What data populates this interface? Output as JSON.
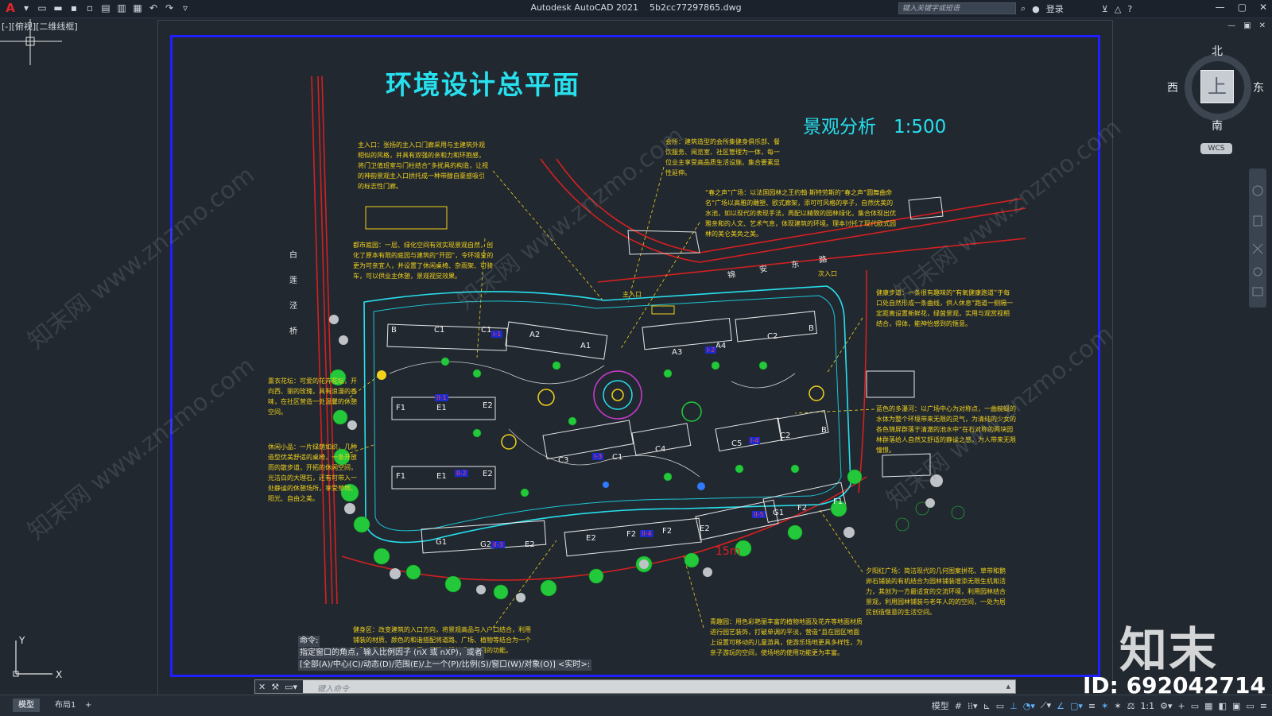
{
  "app": {
    "title": "Autodesk AutoCAD 2021",
    "filename": "5b2cc77297865.dwg",
    "search_placeholder": "键入关键字或短语",
    "login": "登录"
  },
  "viewport": {
    "view_label": "[-][俯视][二维线框]"
  },
  "drawing": {
    "title": "环境设计总平面",
    "subtitle": "景观分析",
    "scale": "1:500",
    "street_west": [
      "白",
      "莲",
      "泾",
      "桥"
    ],
    "street_north": [
      "锦",
      "安",
      "东",
      "路"
    ],
    "labels": {
      "main_entry": "主入口",
      "secondary_entry": "次入口",
      "dimension": "15m"
    },
    "buildings": [
      "B",
      "C1",
      "C1",
      "A2",
      "A1",
      "A3",
      "A4",
      "C2",
      "B",
      "F1",
      "E1",
      "E2",
      "F1",
      "E1",
      "E2",
      "C3",
      "C1",
      "C4",
      "C5",
      "C2",
      "B",
      "G1",
      "G2",
      "E2",
      "E2",
      "F2",
      "F2",
      "E2",
      "G1",
      "F2",
      "F1"
    ],
    "phase_tags": [
      "I-1",
      "II-1",
      "II-2",
      "II-3",
      "I-2",
      "I-3",
      "I-4",
      "II-4",
      "II-5"
    ],
    "notes": {
      "main_entrance": "主入口：张扬的主入口门廊采用与主建筑外观相似的风格，并具有双强的亲和力和环抱感，将门卫值班室与门柱结合“多扰具的构造，让视的神韵景观主入口拱托成一种带醇自豪感吸引的标志性门廊。",
      "clubhouse": "会所：建筑造型的会所集健身俱乐部、餐饮服务、阅览室、社区管理为一体，每一位业主享受高品质生活设施，集合要素显性延伸。",
      "spring_square": "“春之声”广场：以法国园林之王约翰·斯特劳斯的“春之声”圆舞曲命名“广场以高雅的雕塑、欧式廊架，添可可风格的亭子，自然优美的水池，如以现代的表现手法，再配以精致的园林绿化，集合体现出优雅亲和的人文、艺术气息，体现建筑的环境。理本讨托了现代欧式园林的美仑美奂之美。",
      "west_garden": "都市庭园：一层、绿化空间有效实现景观自然，创化了原本有限的庭园与建筑的“开园”，令环境变的更为可亲宜人，并设置了休闲桌椅、杂雨架、可骑车，可以供业主休憩，景观视觉效果。",
      "fragrant": "熏衣花坛：可爱的花卉花坛，开向西、丽的玫瑰，具有浪漫的香味，在社区营造一处温馨的休憩空间。",
      "leisure": "休闲小品：一片绿荫如织，几种造型优美舒适的桌椅，一条开放而的散步道，开拓的休闲空间，光洁白的大理石，还有可带入一处静谧的休憩场所，享受草地、阳光、自由之美。",
      "health_path": "健康步道：一条很有趣味的“有氧健康跑道”于每口处自然形成一条曲线，供人休息“跑道一侧隔一定距离设置新鲜花，绿茵景观，实用与观赏视相结合，得体，能神怡感到的惬意。",
      "blue_water": "蓝色的多瀑河：以广场中心为对称点，一曲蜿蜒的水体为整个环境带来无限的灵气，为清纯的少女的各色锦屏群落于清澈的池水中“在石对称的两块园林群落给人自然又舒适的静谧之感，为人带来无限憧憬。",
      "sunset": "夕阳红广场：简洁现代的几何图案拼花、草带和鹅卵石铺装的有机结合为园林铺装增添无限生机和活力，其创为一方最适宜的交流环境，利用园林结合景观，利用园林铺装与老年人的的空间，一处为居民创造惬意的生活空间。",
      "fitness": "健身区：改变建筑的入口方向，将景观高品与入户口结合，利用铺装的材质、颜色的和谐搭配将道路、广场、植物等结合为一个有整体景观性的环境元素，展现了既美观又实用的功能。",
      "flower_garden": "青趣园：用色彩艳丽丰富的植物地面及花卉等地面材质进行园艺装饰，打破单调的平淡，营造“且在园区地面上设置可移动的儿童游具，使游乐场地更具多样性，为亲子游玩的空间，使场地的使用功能更为丰富。"
    }
  },
  "command": {
    "history": [
      "命令:",
      "指定窗口的角点，输入比例因子 (nX 或 nXP)，或者",
      "[全部(A)/中心(C)/动态(D)/范围(E)/上一个(P)/比例(S)/窗口(W)/对象(O)] <实时>:"
    ],
    "placeholder": "键入命令"
  },
  "navcube": {
    "north": "北",
    "south": "南",
    "east": "东",
    "west": "西",
    "face": "上",
    "wcs": "WCS"
  },
  "ucs": {
    "x": "X",
    "y": "Y"
  },
  "status": {
    "tabs": [
      "模型",
      "布局1"
    ],
    "add_tab": "+",
    "model": "模型",
    "scale": "1:1"
  },
  "watermark": {
    "brand": "知末",
    "id": "ID: 692042714",
    "site": "知末网 www.znzmo.com"
  },
  "colors": {
    "background": "#212830",
    "title": "#27e0ee",
    "notes": "#f2d21b",
    "frame": "#1f1fff",
    "road": "#d42020",
    "garden": "#23c93a"
  }
}
